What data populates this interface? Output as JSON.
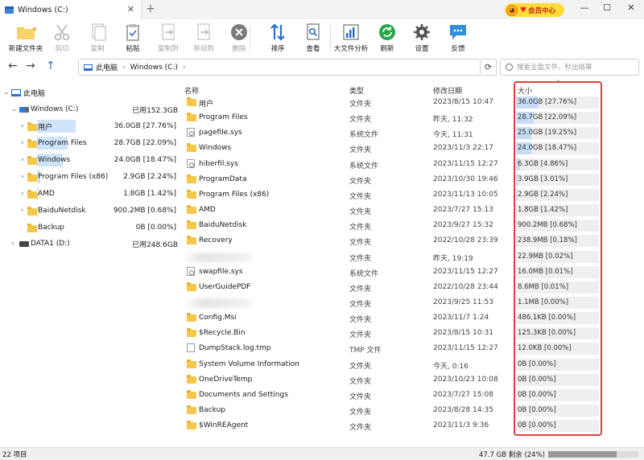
{
  "window": {
    "tab_title": "Windows (C:)",
    "tab_close": "✕",
    "tab_add": "+",
    "vip_label": "会员中心",
    "vip_face": "◕",
    "vip_heart": "♥",
    "controls": {
      "minimize": "—",
      "maximize": "☐",
      "close": "✕"
    }
  },
  "toolbar": [
    {
      "label": "新建文件夹",
      "icon": "new-folder-icon",
      "enabled": true
    },
    {
      "label": "剪切",
      "icon": "scissors-icon",
      "enabled": false
    },
    {
      "label": "复制",
      "icon": "copy-icon",
      "enabled": false
    },
    {
      "label": "粘贴",
      "icon": "paste-icon",
      "enabled": true
    },
    {
      "label": "复制到",
      "icon": "copy-to-icon",
      "enabled": false
    },
    {
      "label": "移动到",
      "icon": "move-to-icon",
      "enabled": false
    },
    {
      "label": "删除",
      "icon": "delete-icon",
      "enabled": false
    },
    {
      "label": "排序",
      "icon": "sort-icon",
      "enabled": true
    },
    {
      "label": "查看",
      "icon": "view-icon",
      "enabled": true
    },
    {
      "label": "大文件分析",
      "icon": "chart-icon",
      "enabled": true
    },
    {
      "label": "刷新",
      "icon": "refresh-icon",
      "enabled": true
    },
    {
      "label": "设置",
      "icon": "gear-icon",
      "enabled": true
    },
    {
      "label": "反馈",
      "icon": "feedback-icon",
      "enabled": true
    }
  ],
  "nav": {
    "back": "←",
    "forward": "→",
    "up": "↑",
    "breadcrumb": [
      "此电脑",
      "Windows (C:)"
    ],
    "chevron": "›",
    "refresh": "⟳",
    "search_placeholder": "搜索全盘文件，秒出结果"
  },
  "tree": {
    "root": "此电脑",
    "drive_c": {
      "label": "Windows (C:)",
      "used": "已用152.3GB"
    },
    "children": [
      {
        "label": "用户",
        "size": "36.0GB [27.76%]",
        "pct": 27.76
      },
      {
        "label": "Program Files",
        "size": "28.7GB [22.09%]",
        "pct": 22.09
      },
      {
        "label": "Windows",
        "size": "24.0GB [18.47%]",
        "pct": 18.47
      },
      {
        "label": "Program Files (x86)",
        "size": "2.9GB [2.24%]",
        "pct": 2.24
      },
      {
        "label": "AMD",
        "size": "1.8GB [1.42%]",
        "pct": 1.42
      },
      {
        "label": "BaiduNetdisk",
        "size": "900.2MB [0.68%]",
        "pct": 0.68
      },
      {
        "label": "Backup",
        "size": "0B [0.00%]",
        "pct": 0
      }
    ],
    "drive_d": {
      "label": "DATA1 (D:)",
      "used": "已用248.6GB"
    }
  },
  "columns": {
    "name": "名称",
    "type": "类型",
    "date": "修改日期",
    "size": "大小"
  },
  "files": [
    {
      "name": "用户",
      "kind": "folder",
      "type": "文件夹",
      "date": "2023/8/15 10:47",
      "size": "36.0GB [27.76%]",
      "pct": 27.76
    },
    {
      "name": "Program Files",
      "kind": "folder",
      "type": "文件夹",
      "date": "昨天, 11:32",
      "size": "28.7GB [22.09%]",
      "pct": 22.09
    },
    {
      "name": "pagefile.sys",
      "kind": "sys",
      "type": "系统文件",
      "date": "今天, 11:31",
      "size": "25.0GB [19.25%]",
      "pct": 19.25
    },
    {
      "name": "Windows",
      "kind": "folder",
      "type": "文件夹",
      "date": "2023/11/3 22:17",
      "size": "24.0GB [18.47%]",
      "pct": 18.47
    },
    {
      "name": "hiberfil.sys",
      "kind": "sys",
      "type": "系统文件",
      "date": "2023/11/15 12:27",
      "size": "6.3GB [4.86%]",
      "pct": 4.86
    },
    {
      "name": "ProgramData",
      "kind": "folder",
      "type": "文件夹",
      "date": "2023/10/30 19:46",
      "size": "3.9GB [3.01%]",
      "pct": 3.01
    },
    {
      "name": "Program Files (x86)",
      "kind": "folder",
      "type": "文件夹",
      "date": "2023/11/13 10:05",
      "size": "2.9GB [2.24%]",
      "pct": 2.24
    },
    {
      "name": "AMD",
      "kind": "folder",
      "type": "文件夹",
      "date": "2023/7/27 15:13",
      "size": "1.8GB [1.42%]",
      "pct": 1.42
    },
    {
      "name": "BaiduNetdisk",
      "kind": "folder",
      "type": "文件夹",
      "date": "2023/9/27 15:32",
      "size": "900.2MB [0.68%]",
      "pct": 0.68
    },
    {
      "name": "Recovery",
      "kind": "folder",
      "type": "文件夹",
      "date": "2022/10/28 23:39",
      "size": "238.9MB [0.18%]",
      "pct": 0.18
    },
    {
      "name": "",
      "kind": "blurred",
      "type": "文件夹",
      "date": "昨天, 19:19",
      "size": "22.9MB [0.02%]",
      "pct": 0.02
    },
    {
      "name": "swapfile.sys",
      "kind": "sys",
      "type": "系统文件",
      "date": "2023/11/15 12:27",
      "size": "16.0MB [0.01%]",
      "pct": 0.01
    },
    {
      "name": "UserGuidePDF",
      "kind": "folder",
      "type": "文件夹",
      "date": "2022/10/28 23:44",
      "size": "8.6MB [0.01%]",
      "pct": 0.01
    },
    {
      "name": "",
      "kind": "blurred",
      "type": "文件夹",
      "date": "2023/9/25 11:53",
      "size": "1.1MB [0.00%]",
      "pct": 0
    },
    {
      "name": "Config.Msi",
      "kind": "folder",
      "type": "文件夹",
      "date": "2023/11/7 1:24",
      "size": "486.1KB [0.00%]",
      "pct": 0
    },
    {
      "name": "$Recycle.Bin",
      "kind": "folder",
      "type": "文件夹",
      "date": "2023/8/15 10:31",
      "size": "125.3KB [0.00%]",
      "pct": 0
    },
    {
      "name": "DumpStack.log.tmp",
      "kind": "file",
      "type": "TMP 文件",
      "date": "2023/11/15 12:27",
      "size": "12.0KB [0.00%]",
      "pct": 0
    },
    {
      "name": "System Volume Information",
      "kind": "folder",
      "type": "文件夹",
      "date": "今天, 0:16",
      "size": "0B [0.00%]",
      "pct": 0
    },
    {
      "name": "OneDriveTemp",
      "kind": "folder",
      "type": "文件夹",
      "date": "2023/10/23 10:08",
      "size": "0B [0.00%]",
      "pct": 0
    },
    {
      "name": "Documents and Settings",
      "kind": "folder",
      "type": "文件夹",
      "date": "2023/7/27 15:08",
      "size": "0B [0.00%]",
      "pct": 0
    },
    {
      "name": "Backup",
      "kind": "folder",
      "type": "文件夹",
      "date": "2023/8/28 14:35",
      "size": "0B [0.00%]",
      "pct": 0
    },
    {
      "name": "$WinREAgent",
      "kind": "folder",
      "type": "文件夹",
      "date": "2023/11/3 9:36",
      "size": "0B [0.00%]",
      "pct": 0
    }
  ],
  "status": {
    "item_count": "22 项目",
    "free": "47.7 GB 剩余 (24%)",
    "used_fraction": 0.76
  }
}
